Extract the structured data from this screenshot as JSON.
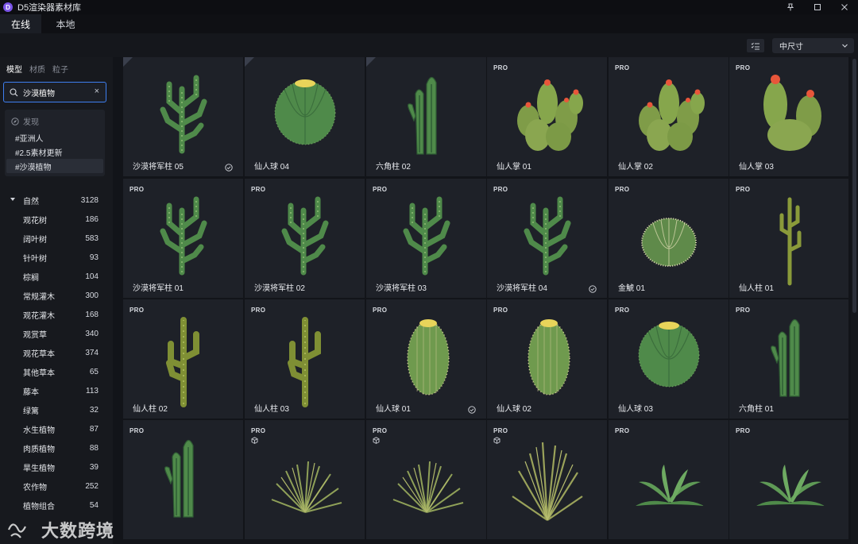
{
  "app": {
    "logo_letter": "D",
    "title": "D5渲染器素材库"
  },
  "tabs": [
    {
      "label": "在线",
      "active": true
    },
    {
      "label": "本地",
      "active": false
    }
  ],
  "toolbar": {
    "size_selected": "中尺寸"
  },
  "sidebar": {
    "subtabs": [
      {
        "label": "模型",
        "active": true
      },
      {
        "label": "材质",
        "active": false
      },
      {
        "label": "粒子",
        "active": false
      }
    ],
    "search": {
      "value": "沙漠植物",
      "clear": "×"
    },
    "suggestions": {
      "header": "发现",
      "items": [
        "#亚洲人",
        "#2.5素材更新",
        "#沙漠植物"
      ]
    },
    "categories": [
      {
        "name": "自然",
        "count": "3128",
        "root": true
      },
      {
        "name": "观花树",
        "count": "186"
      },
      {
        "name": "阔叶树",
        "count": "583"
      },
      {
        "name": "针叶树",
        "count": "93"
      },
      {
        "name": "棕榈",
        "count": "104"
      },
      {
        "name": "常规灌木",
        "count": "300"
      },
      {
        "name": "观花灌木",
        "count": "168"
      },
      {
        "name": "观赏草",
        "count": "340"
      },
      {
        "name": "观花草本",
        "count": "374"
      },
      {
        "name": "其他草本",
        "count": "65"
      },
      {
        "name": "藤本",
        "count": "113"
      },
      {
        "name": "绿篱",
        "count": "32"
      },
      {
        "name": "水生植物",
        "count": "87"
      },
      {
        "name": "肉质植物",
        "count": "88"
      },
      {
        "name": "旱生植物",
        "count": "39"
      },
      {
        "name": "农作物",
        "count": "252"
      },
      {
        "name": "植物组合",
        "count": "54"
      }
    ]
  },
  "assets": [
    {
      "name": "沙漠将军柱 05",
      "pro": false,
      "downloaded": true,
      "kind": "column-branch"
    },
    {
      "name": "仙人球 04",
      "pro": false,
      "downloaded": false,
      "kind": "barrel-flower"
    },
    {
      "name": "六角柱 02",
      "pro": false,
      "downloaded": false,
      "kind": "hex-column"
    },
    {
      "name": "仙人掌 01",
      "pro": true,
      "downloaded": false,
      "kind": "cluster"
    },
    {
      "name": "仙人掌 02",
      "pro": true,
      "downloaded": false,
      "kind": "cluster"
    },
    {
      "name": "仙人掌 03",
      "pro": true,
      "downloaded": false,
      "kind": "cluster-tall"
    },
    {
      "name": "沙漠将军柱 01",
      "pro": true,
      "downloaded": false,
      "kind": "column-branch"
    },
    {
      "name": "沙漠将军柱 02",
      "pro": true,
      "downloaded": false,
      "kind": "column-branch"
    },
    {
      "name": "沙漠将军柱 03",
      "pro": true,
      "downloaded": false,
      "kind": "column-branch"
    },
    {
      "name": "沙漠将军柱 04",
      "pro": true,
      "downloaded": true,
      "kind": "column-branch"
    },
    {
      "name": "金鯱 01",
      "pro": true,
      "downloaded": false,
      "kind": "barrel-spiky"
    },
    {
      "name": "仙人柱 01",
      "pro": true,
      "downloaded": false,
      "kind": "saguaro-thin"
    },
    {
      "name": "仙人柱 02",
      "pro": true,
      "downloaded": false,
      "kind": "saguaro"
    },
    {
      "name": "仙人柱 03",
      "pro": true,
      "downloaded": false,
      "kind": "saguaro"
    },
    {
      "name": "仙人球 01",
      "pro": true,
      "downloaded": true,
      "kind": "barrel-tall"
    },
    {
      "name": "仙人球 02",
      "pro": true,
      "downloaded": false,
      "kind": "barrel-tall"
    },
    {
      "name": "仙人球 03",
      "pro": true,
      "downloaded": false,
      "kind": "barrel-flower"
    },
    {
      "name": "六角柱 01",
      "pro": true,
      "downloaded": false,
      "kind": "hex-column"
    },
    {
      "name": "",
      "pro": true,
      "downloaded": false,
      "cube": false,
      "kind": "hex-column"
    },
    {
      "name": "",
      "pro": true,
      "downloaded": false,
      "cube": true,
      "kind": "grass"
    },
    {
      "name": "",
      "pro": true,
      "downloaded": false,
      "cube": true,
      "kind": "grass"
    },
    {
      "name": "",
      "pro": true,
      "downloaded": false,
      "cube": true,
      "kind": "grass-tall"
    },
    {
      "name": "",
      "pro": true,
      "downloaded": false,
      "cube": false,
      "kind": "agave"
    },
    {
      "name": "",
      "pro": true,
      "downloaded": false,
      "cube": false,
      "kind": "agave"
    }
  ],
  "badges": {
    "pro": "PRO"
  },
  "watermark": {
    "text": "大数跨境"
  },
  "colors": {
    "accent": "#3e7ef0",
    "logo": "#7b55e8",
    "cactus": "#4f8a4a",
    "flower": "#e8563a"
  }
}
